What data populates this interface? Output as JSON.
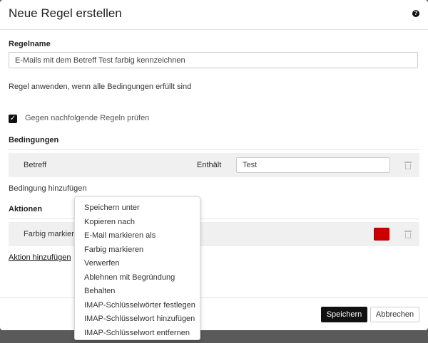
{
  "dialog": {
    "title": "Neue Regel erstellen",
    "help_glyph": "?"
  },
  "rule_name": {
    "label": "Regelname",
    "value": "E-Mails mit dem Betreff Test farbig kennzeichnen"
  },
  "apply_text": "Regel anwenden, wenn alle Bedingungen erfüllt sind",
  "check_following": {
    "label": "Gegen nachfolgende Regeln prüfen",
    "checked": true
  },
  "conditions": {
    "heading": "Bedingungen",
    "rows": [
      {
        "field": "Betreff",
        "operator": "Enthält",
        "value": "Test"
      }
    ],
    "add_label": "Bedingung hinzufügen"
  },
  "actions": {
    "heading": "Aktionen",
    "rows": [
      {
        "label": "Farbig markieren",
        "color": "#cc0000"
      }
    ],
    "add_label": "Aktion hinzufügen"
  },
  "dropdown": {
    "items": [
      "Speichern unter",
      "Kopieren nach",
      "E-Mail markieren als",
      "Farbig markieren",
      "Verwerfen",
      "Ablehnen mit Begründung",
      "Behalten",
      "IMAP-Schlüsselwörter festlegen",
      "IMAP-Schlüsselwort hinzufügen",
      "IMAP-Schlüsselwort entfernen"
    ]
  },
  "footer": {
    "save_label": "Speichern",
    "cancel_label": "Abbrechen"
  }
}
